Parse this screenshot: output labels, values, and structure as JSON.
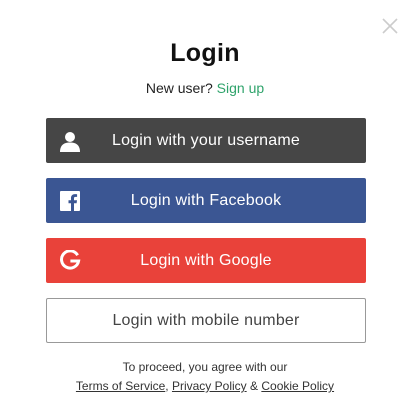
{
  "dialog": {
    "title": "Login",
    "new_user_prompt": "New user?",
    "signup_link": "Sign up",
    "close_icon": "close-icon"
  },
  "buttons": {
    "username": {
      "label": "Login with your username",
      "icon": "user-icon",
      "color": "#464646"
    },
    "facebook": {
      "label": "Login with Facebook",
      "icon": "facebook-icon",
      "color": "#3b5693"
    },
    "google": {
      "label": "Login with Google",
      "icon": "google-icon",
      "color": "#e9423a"
    },
    "mobile": {
      "label": "Login with mobile number",
      "color": "#ffffff"
    }
  },
  "terms": {
    "intro": "To proceed, you agree with our",
    "terms_of_service": "Terms of Service",
    "separator_comma": ",",
    "privacy_policy": "Privacy Policy",
    "separator_amp": "&",
    "cookie_policy": "Cookie Policy"
  },
  "colors": {
    "accent": "#2fa36b"
  }
}
